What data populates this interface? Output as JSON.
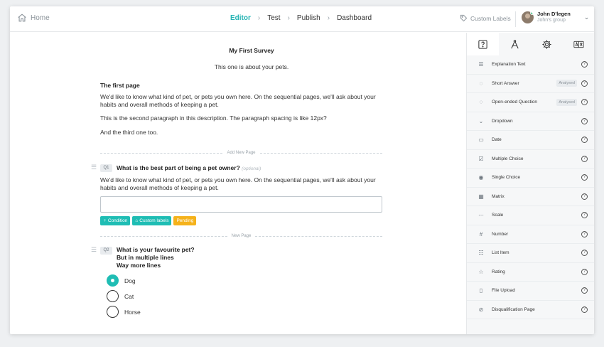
{
  "topbar": {
    "home_label": "Home",
    "tabs": [
      "Editor",
      "Test",
      "Publish",
      "Dashboard"
    ],
    "active_tab": "Editor",
    "custom_labels": "Custom Labels",
    "user_name": "John D'legen",
    "user_group": "John's group"
  },
  "survey": {
    "title": "My First Survey",
    "subtitle": "This one is about your pets.",
    "page_title": "The first page",
    "paragraph1": "We'd like to know what kind of pet, or pets you own here. On the sequential pages, we'll ask about your habits and overall methods of keeping a pet.",
    "paragraph2": "This is the second paragraph in this description. The paragraph spacing is like 12px?",
    "paragraph3": "And the third one too.",
    "add_new_page": "Add New Page",
    "new_page": "New Page"
  },
  "q1": {
    "number": "Q1",
    "text": "What is the best part of being a pet owner?",
    "optional": "(optional)",
    "description": "We'd like to know what kind of pet, or pets you own here. On the sequential pages, we'll ask about your habits and overall methods of keeping a pet.",
    "answer_value": "",
    "tags": [
      "Condition",
      "Custom labels",
      "Pending"
    ]
  },
  "q2": {
    "number": "Q2",
    "line1": "What is your favourite pet?",
    "line2": "But in multiple lines",
    "line3": "Way more lines",
    "options": [
      "Dog",
      "Cat",
      "Horse"
    ],
    "selected": "Dog"
  },
  "panel": {
    "tabs": [
      "help-icon",
      "compass-icon",
      "gear-icon",
      "translate-icon"
    ],
    "items": [
      {
        "label": "Explanation Text",
        "icon": "☰",
        "badge": ""
      },
      {
        "label": "Short Answer",
        "icon": "◌",
        "badge": "Analysed"
      },
      {
        "label": "Open-ended Question",
        "icon": "◌",
        "badge": "Analysed"
      },
      {
        "label": "Dropdown",
        "icon": "⌄",
        "badge": ""
      },
      {
        "label": "Date",
        "icon": "▭",
        "badge": ""
      },
      {
        "label": "Multiple Choice",
        "icon": "☑",
        "badge": ""
      },
      {
        "label": "Single Choice",
        "icon": "◉",
        "badge": ""
      },
      {
        "label": "Matrix",
        "icon": "▦",
        "badge": ""
      },
      {
        "label": "Scale",
        "icon": "⋯",
        "badge": ""
      },
      {
        "label": "Number",
        "icon": "#",
        "badge": ""
      },
      {
        "label": "List Item",
        "icon": "☷",
        "badge": ""
      },
      {
        "label": "Rating",
        "icon": "☆",
        "badge": ""
      },
      {
        "label": "File Upload",
        "icon": "▯",
        "badge": ""
      },
      {
        "label": "Disqualification Page",
        "icon": "⊘",
        "badge": ""
      }
    ],
    "help_glyph": "?"
  },
  "colors": {
    "accent": "#24b3b3",
    "tag_teal": "#1fbdb4",
    "tag_amber": "#f5b21b"
  }
}
